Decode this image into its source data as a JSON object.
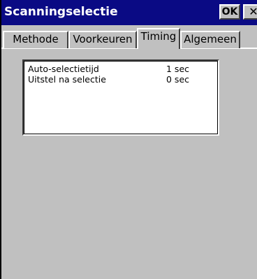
{
  "window": {
    "title": "Scanningselectie",
    "ok_label": "OK",
    "close_label": "✕"
  },
  "tabs": [
    {
      "label": "Methode",
      "active": false
    },
    {
      "label": "Voorkeuren",
      "active": false
    },
    {
      "label": "Timing",
      "active": true
    },
    {
      "label": "Algemeen",
      "active": false
    }
  ],
  "timing": {
    "rows": [
      {
        "label": "Auto-selectietijd",
        "value": "1 sec"
      },
      {
        "label": "Uitstel na selectie",
        "value": "0 sec"
      }
    ]
  },
  "colors": {
    "titlebar": "#0a0a84",
    "face": "#c0c0c0",
    "list_background": "#ffffff"
  }
}
